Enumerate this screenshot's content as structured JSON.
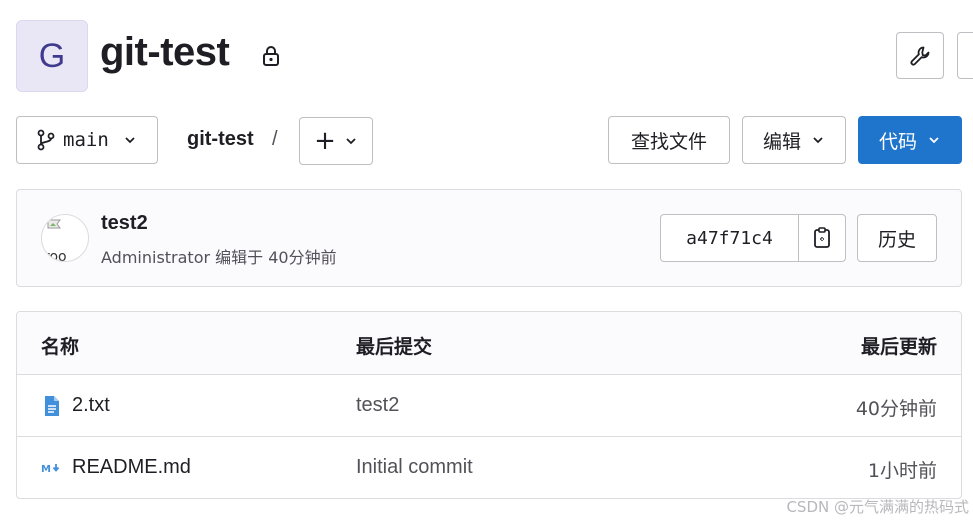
{
  "project": {
    "avatar_letter": "G",
    "name": "git-test"
  },
  "toolbar": {
    "branch": "main",
    "breadcrumb": "git-test",
    "breadcrumb_sep": "/",
    "add_label": "+",
    "find_file_label": "查找文件",
    "edit_label": "编辑",
    "code_label": "代码"
  },
  "last_commit": {
    "title": "test2",
    "meta": "Administrator 编辑于 40分钟前",
    "sha": "a47f71c4",
    "history_label": "历史",
    "avatar_alt": "roo"
  },
  "files": {
    "headers": {
      "name": "名称",
      "commit": "最后提交",
      "updated": "最后更新"
    },
    "rows": [
      {
        "name": "2.txt",
        "commit": "test2",
        "updated": "40分钟前",
        "icon": "file-text-icon"
      },
      {
        "name": "README.md",
        "commit": "Initial commit",
        "updated": "1小时前",
        "icon": "markdown-icon"
      }
    ]
  },
  "watermark": "CSDN @元气满满的热码式",
  "colors": {
    "primary": "#1f75cb",
    "avatar_bg": "#e9e6f6",
    "file_icon": "#428fdc"
  }
}
